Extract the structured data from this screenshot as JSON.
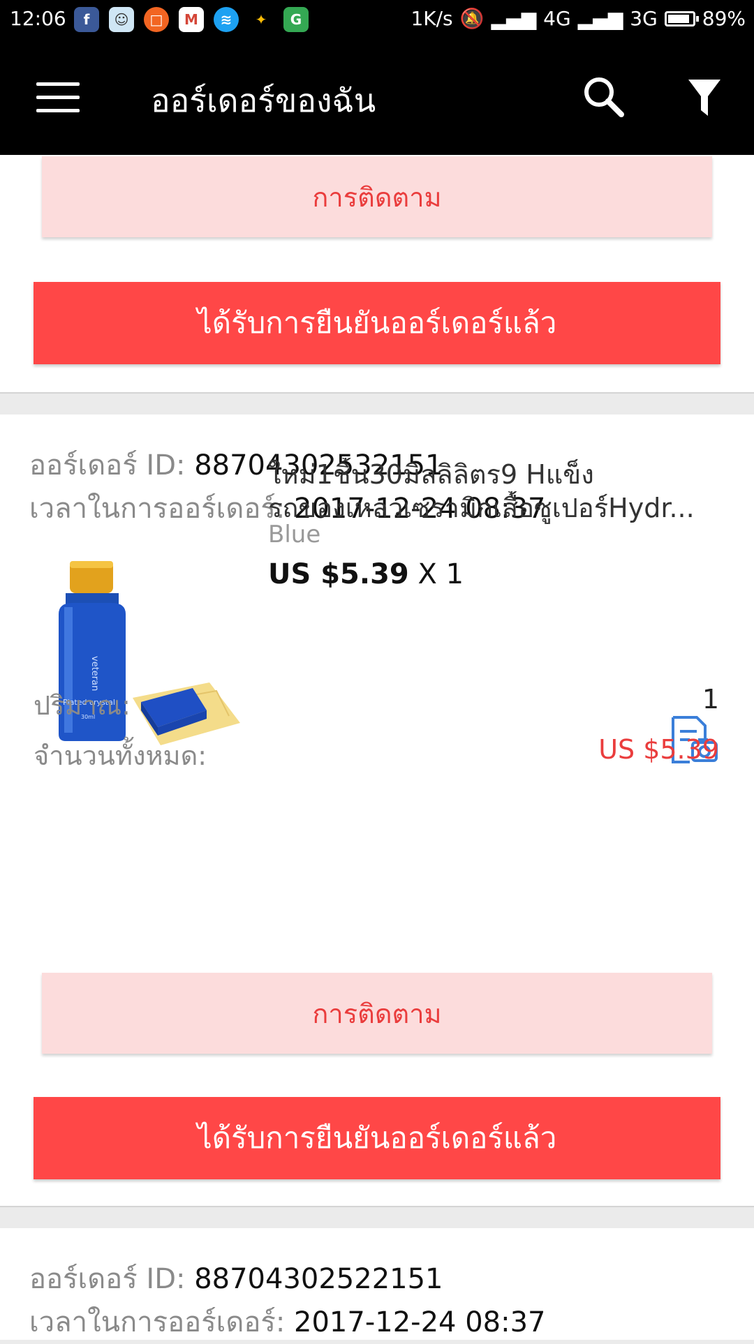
{
  "status_bar": {
    "time": "12:06",
    "net_speed": "1K/s",
    "network_1": "4G",
    "network_2": "3G",
    "battery": "89%",
    "notification_icons": [
      "facebook-icon",
      "avatar-app-icon",
      "orange-app-icon",
      "gmail-icon",
      "wifi-icon",
      "pinwheel-icon",
      "maps-icon"
    ]
  },
  "toolbar": {
    "title": "ออร์เดอร์ของฉัน",
    "icons": [
      "menu-icon",
      "search-icon",
      "filter-icon"
    ]
  },
  "order_top": {
    "track_label": "การติดตาม",
    "confirm_label": "ได้รับการยืนยันออร์เดอร์แล้ว"
  },
  "order_1": {
    "id_label": "ออร์เดอร์ ID:",
    "id": "88704302532151",
    "time_label": "เวลาในการออร์เดอร์:",
    "time": "2017-12-24 08:37",
    "product": {
      "title_line1": "ใหม่1ชิ้น30มิลลิลิตร9 Hแข็ง",
      "title_line2": "รถของเหลวเซรามิกเสื้อซูเปอร์Hydr...",
      "variant": "Blue",
      "price": "US $5.39",
      "qty_text": "X 1",
      "bottle_text": "veteran",
      "bottle_text2": "Plated crystal",
      "bottle_text3": "30ml"
    },
    "quantity_label": "ปริมาณ:",
    "quantity": "1",
    "total_label": "จำนวนทั้งหมด:",
    "total": "US $5.39",
    "track_label": "การติดตาม",
    "confirm_label": "ได้รับการยืนยันออร์เดอร์แล้ว"
  },
  "order_2": {
    "id_label": "ออร์เดอร์ ID:",
    "id": "88704302522151",
    "time_label": "เวลาในการออร์เดอร์:",
    "time": "2017-12-24 08:37"
  },
  "colors": {
    "accent_red": "#ff4747",
    "track_bg": "#fcdcdc",
    "link_blue": "#3b7fd9"
  }
}
